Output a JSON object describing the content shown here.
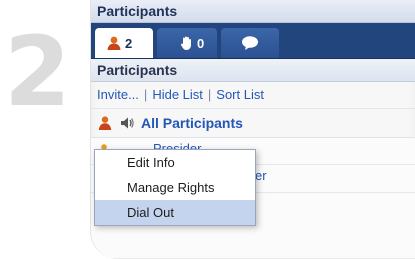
{
  "step": {
    "number": "2"
  },
  "panel": {
    "title": "Participants",
    "tabs": [
      {
        "icon": "people-icon",
        "count": "2",
        "active": true
      },
      {
        "icon": "raised-hand-icon",
        "count": "0",
        "active": false
      },
      {
        "icon": "chat-bubble-icon",
        "count": "",
        "active": false
      }
    ],
    "section_title": "Participants",
    "links": {
      "invite": "Invite...",
      "hide_list": "Hide List",
      "sort_list": "Sort List",
      "separator": "|"
    },
    "all_participants": {
      "label": "All Participants",
      "icons": [
        "people-icon",
        "speaker-icon"
      ]
    },
    "rows": [
      {
        "text": "Presider"
      },
      {
        "text": "er"
      }
    ]
  },
  "context_menu": {
    "items": [
      {
        "label": "Edit Info",
        "selected": false
      },
      {
        "label": "Manage Rights",
        "selected": false
      },
      {
        "label": "Dial Out",
        "selected": true
      }
    ]
  },
  "colors": {
    "tab_bar": "#23457d",
    "link": "#2456b8",
    "menu_highlight": "#c4d3ee",
    "step_number": "#dcdcdc"
  }
}
